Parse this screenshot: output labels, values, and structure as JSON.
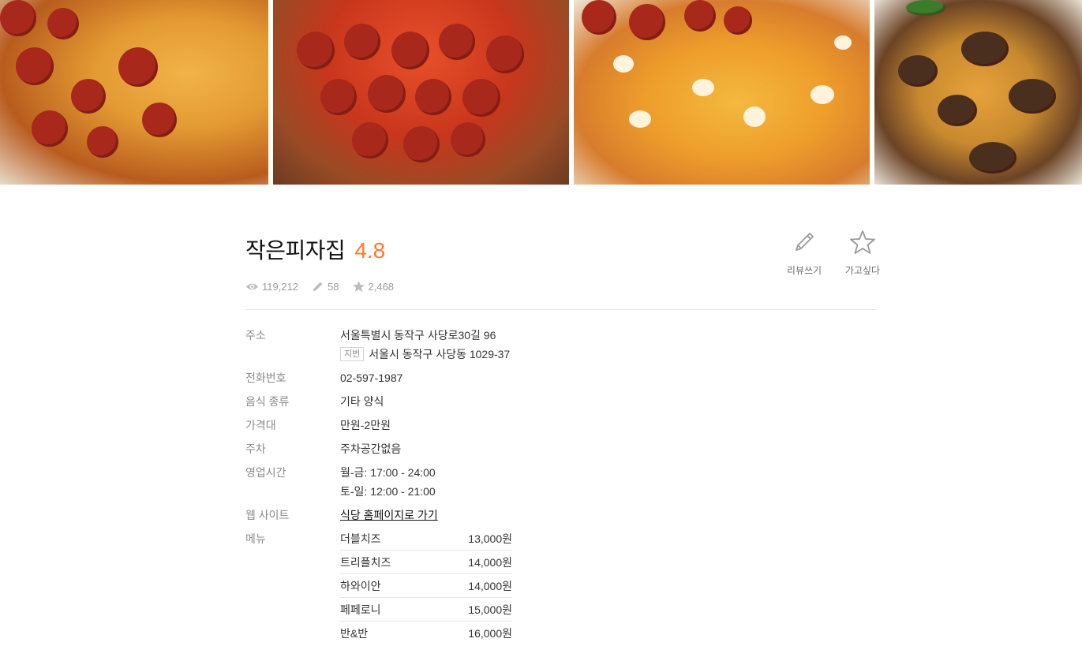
{
  "restaurant": {
    "name": "작은피자집",
    "rating": "4.8"
  },
  "stats": {
    "views": "119,212",
    "reviews": "58",
    "wishlist": "2,468"
  },
  "actions": {
    "write_review": "리뷰쓰기",
    "want_to_go": "가고싶다"
  },
  "info": {
    "address_label": "주소",
    "address": "서울특별시 동작구 사당로30길 96",
    "jibun_tag": "지번",
    "jibun_address": "서울시 동작구 사당동 1029-37",
    "phone_label": "전화번호",
    "phone": "02-597-1987",
    "food_label": "음식 종류",
    "food": "기타 양식",
    "price_label": "가격대",
    "price": "만원-2만원",
    "parking_label": "주차",
    "parking": "주차공간없음",
    "hours_label": "영업시간",
    "hours_weekday": "월-금: 17:00 - 24:00",
    "hours_weekend": "토-일: 12:00 - 21:00",
    "website_label": "웹 사이트",
    "website_link": "식당 홈페이지로 가기",
    "menu_label": "메뉴"
  },
  "menu": [
    {
      "name": "더블치즈",
      "price": "13,000원"
    },
    {
      "name": "트리플치즈",
      "price": "14,000원"
    },
    {
      "name": "하와이안",
      "price": "14,000원"
    },
    {
      "name": "페페로니",
      "price": "15,000원"
    },
    {
      "name": "반&반",
      "price": "16,000원"
    }
  ],
  "colors": {
    "rating": "#ff7a2f",
    "label": "#8a8a8a",
    "stat": "#9b9b9b"
  },
  "icons": [
    "eye-icon",
    "pencil-icon",
    "star-icon",
    "edit-pencil-icon",
    "star-outline-icon"
  ]
}
